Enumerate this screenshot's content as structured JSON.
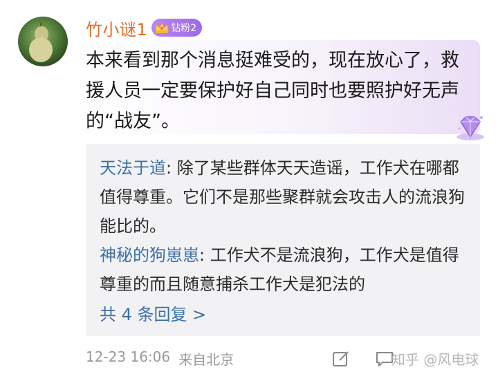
{
  "comment": {
    "username": "竹小谜1",
    "fan_badge": "钻粉2",
    "text": "本来看到那个消息挺难受的，现在放心了，救援人员一定要保护好自己同时也要照护好无声的“战友”。"
  },
  "replies": [
    {
      "user": "天法于道",
      "separator": ": ",
      "text": "除了某些群体天天造谣，工作犬在哪都值得尊重。它们不是那些聚群就会攻击人的流浪狗能比的。"
    },
    {
      "user": "神秘的狗崽崽",
      "separator": ": ",
      "text": "工作犬不是流浪狗，工作犬是值得尊重的而且随意捕杀工作犬是犯法的"
    }
  ],
  "more_replies_label": "共 4 条回复 >",
  "footer": {
    "date": "12-23 16:06",
    "location": "来自北京"
  },
  "watermark": "知乎 @风电球",
  "colors": {
    "username": "#e86b1f",
    "reply_user": "#3b6fa8",
    "badge": "#a777ee"
  },
  "icons": [
    "avatar-gourd",
    "crown-icon",
    "diamond-badge-icon",
    "edit-icon",
    "comment-icon"
  ]
}
